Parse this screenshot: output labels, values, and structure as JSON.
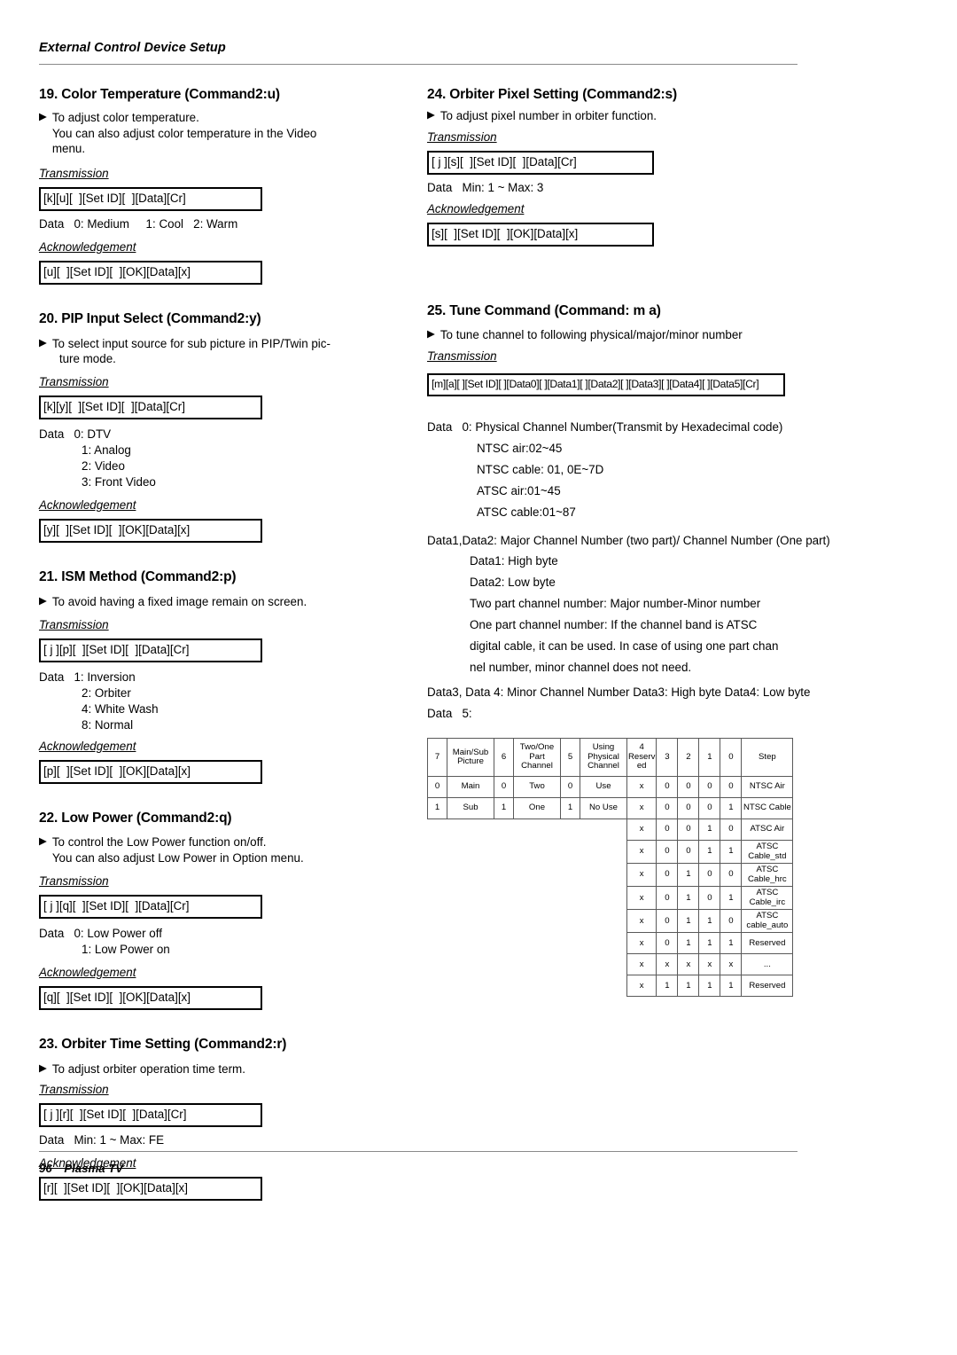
{
  "header": {
    "running_title": "External Control Device Setup"
  },
  "footer": {
    "page_number": "96",
    "product": "Plasma TV"
  },
  "labels": {
    "transmission": "Transmission",
    "acknowledgement": "Acknowledgement",
    "bullet_icon": "play-triangle-icon"
  },
  "sections": {
    "s19": {
      "heading": "19. Color Temperature (Command2:u)",
      "desc_line1": "To adjust color temperature.",
      "desc_line2": "You can also adjust color temperature in the Video",
      "desc_line3": "menu.",
      "transmission_code": "[k][u][  ][Set ID][  ][Data][Cr]",
      "data_line": "Data   0: Medium     1: Cool   2: Warm",
      "ack_code": "[u][  ][Set ID][  ][OK][Data][x]"
    },
    "s20": {
      "heading": "20. PIP Input Select (Command2:y)",
      "desc_line1": "To select input source for sub picture in PIP/Twin pic-",
      "desc_line2": "ture mode.",
      "transmission_code": "[k][y][  ][Set ID][  ][Data][Cr]",
      "data_head": "Data   0: DTV",
      "data_items": [
        "1: Analog",
        "2: Video",
        "3: Front Video"
      ],
      "ack_code": "[y][  ][Set ID][  ][OK][Data][x]"
    },
    "s21": {
      "heading": "21. ISM Method (Command2:p)",
      "desc_line1": "To avoid having a fixed image remain on screen.",
      "transmission_code": "[ j ][p][  ][Set ID][  ][Data][Cr]",
      "data_head": "Data   1: Inversion",
      "data_items": [
        "2: Orbiter",
        "4: White Wash",
        "8: Normal"
      ],
      "ack_code": "[p][  ][Set ID][  ][OK][Data][x]"
    },
    "s22": {
      "heading": "22. Low Power (Command2:q)",
      "desc_line1": "To control the Low Power function on/off.",
      "desc_line2": "You can also adjust Low Power in Option menu.",
      "transmission_code": "[ j ][q][  ][Set ID][  ][Data][Cr]",
      "data_head": "Data   0: Low Power off",
      "data_items": [
        "1: Low Power on"
      ],
      "ack_code": "[q][  ][Set ID][  ][OK][Data][x]"
    },
    "s23": {
      "heading": "23. Orbiter Time Setting (Command2:r)",
      "desc_line1": "To adjust orbiter operation time term.",
      "transmission_code": "[ j ][r][  ][Set ID][  ][Data][Cr]",
      "data_line": "Data   Min: 1 ~ Max: FE",
      "ack_code": "[r][  ][Set ID][  ][OK][Data][x]"
    },
    "s24": {
      "heading": "24. Orbiter Pixel Setting (Command2:s)",
      "desc_line1": "To adjust pixel number in orbiter function.",
      "transmission_code": "[ j ][s][  ][Set ID][  ][Data][Cr]",
      "data_line": "Data   Min: 1 ~ Max: 3",
      "ack_code": "[s][  ][Set ID][  ][OK][Data][x]"
    },
    "s25": {
      "heading": "25. Tune Command (Command: m a)",
      "desc_line1": "To tune channel to following physical/major/minor number",
      "transmission_code": "[m][a][ ][Set ID][ ][Data0][ ][Data1][ ][Data2][ ][Data3][ ][Data4][ ][Data5][Cr]",
      "data0_head": "Data   0: Physical Channel Number(Transmit by Hexadecimal code)",
      "data0_items": [
        "NTSC air:02~45",
        "NTSC cable: 01, 0E~7D",
        "ATSC air:01~45",
        "ATSC cable:01~87"
      ],
      "data12_head": "Data1,Data2: Major Channel Number (two part)/ Channel Number (One part)",
      "data12_items": [
        "Data1: High byte",
        "Data2: Low byte",
        "Two part channel number: Major number-Minor number",
        "One part channel number: If the channel band is ATSC",
        "digital cable, it can be used. In case of using one part chan",
        "nel number, minor channel does not need."
      ],
      "data34_line": "Data3, Data 4: Minor Channel Number Data3: High byte Data4: Low byte",
      "data5_line": "Data   5:"
    }
  },
  "bit_table": {
    "header": [
      "7",
      "Main/Sub Picture",
      "6",
      "Two/One Part Channel",
      "5",
      "Using Physical Channel",
      "4 Reserv ed",
      "3",
      "2",
      "1",
      "0",
      "Step"
    ],
    "left_rows": [
      [
        "0",
        "Main",
        "0",
        "Two",
        "0",
        "Use"
      ],
      [
        "1",
        "Sub",
        "1",
        "One",
        "1",
        "No Use"
      ]
    ],
    "right_rows": [
      [
        "x",
        "0",
        "0",
        "0",
        "0",
        "NTSC Air"
      ],
      [
        "x",
        "0",
        "0",
        "0",
        "1",
        "NTSC Cable"
      ],
      [
        "x",
        "0",
        "0",
        "1",
        "0",
        "ATSC Air"
      ],
      [
        "x",
        "0",
        "0",
        "1",
        "1",
        "ATSC Cable_std"
      ],
      [
        "x",
        "0",
        "1",
        "0",
        "0",
        "ATSC Cable_hrc"
      ],
      [
        "x",
        "0",
        "1",
        "0",
        "1",
        "ATSC Cable_irc"
      ],
      [
        "x",
        "0",
        "1",
        "1",
        "0",
        "ATSC cable_auto"
      ],
      [
        "x",
        "0",
        "1",
        "1",
        "1",
        "Reserved"
      ],
      [
        "x",
        "x",
        "x",
        "x",
        "x",
        "..."
      ],
      [
        "x",
        "1",
        "1",
        "1",
        "1",
        "Reserved"
      ]
    ]
  }
}
